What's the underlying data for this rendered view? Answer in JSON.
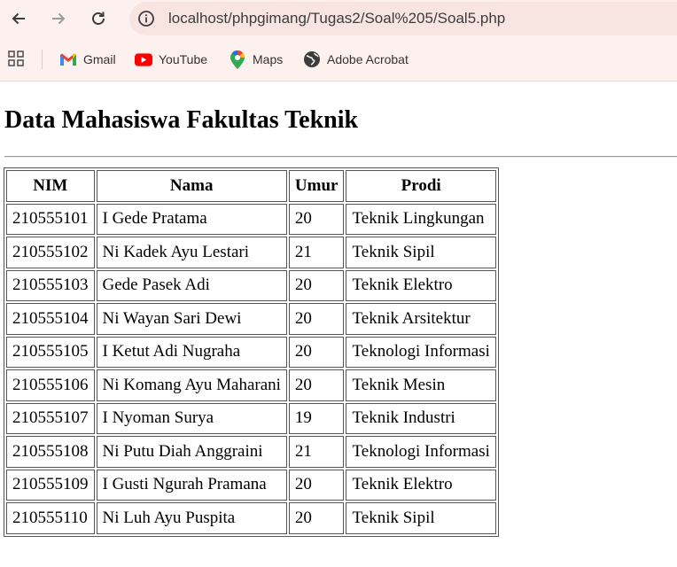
{
  "browser": {
    "url": "localhost/phpgimang/Tugas2/Soal%205/Soal5.php",
    "bookmarks": [
      {
        "label": "Gmail",
        "icon": "gmail-icon"
      },
      {
        "label": "YouTube",
        "icon": "youtube-icon"
      },
      {
        "label": "Maps",
        "icon": "maps-icon"
      },
      {
        "label": "Adobe Acrobat",
        "icon": "globe-icon"
      }
    ]
  },
  "page": {
    "title": "Data Mahasiswa Fakultas Teknik"
  },
  "table": {
    "headers": [
      "NIM",
      "Nama",
      "Umur",
      "Prodi"
    ],
    "rows": [
      [
        "210555101",
        "I Gede Pratama",
        "20",
        "Teknik Lingkungan"
      ],
      [
        "210555102",
        "Ni Kadek Ayu Lestari",
        "21",
        "Teknik Sipil"
      ],
      [
        "210555103",
        "Gede Pasek Adi",
        "20",
        "Teknik Elektro"
      ],
      [
        "210555104",
        "Ni Wayan Sari Dewi",
        "20",
        "Teknik Arsitektur"
      ],
      [
        "210555105",
        "I Ketut Adi Nugraha",
        "20",
        "Teknologi Informasi"
      ],
      [
        "210555106",
        "Ni Komang Ayu Maharani",
        "20",
        "Teknik Mesin"
      ],
      [
        "210555107",
        "I Nyoman Surya",
        "19",
        "Teknik Industri"
      ],
      [
        "210555108",
        "Ni Putu Diah Anggraini",
        "21",
        "Teknologi Informasi"
      ],
      [
        "210555109",
        "I Gusti Ngurah Pramana",
        "20",
        "Teknik Elektro"
      ],
      [
        "210555110",
        "Ni Luh Ayu Puspita",
        "20",
        "Teknik Sipil"
      ]
    ]
  }
}
